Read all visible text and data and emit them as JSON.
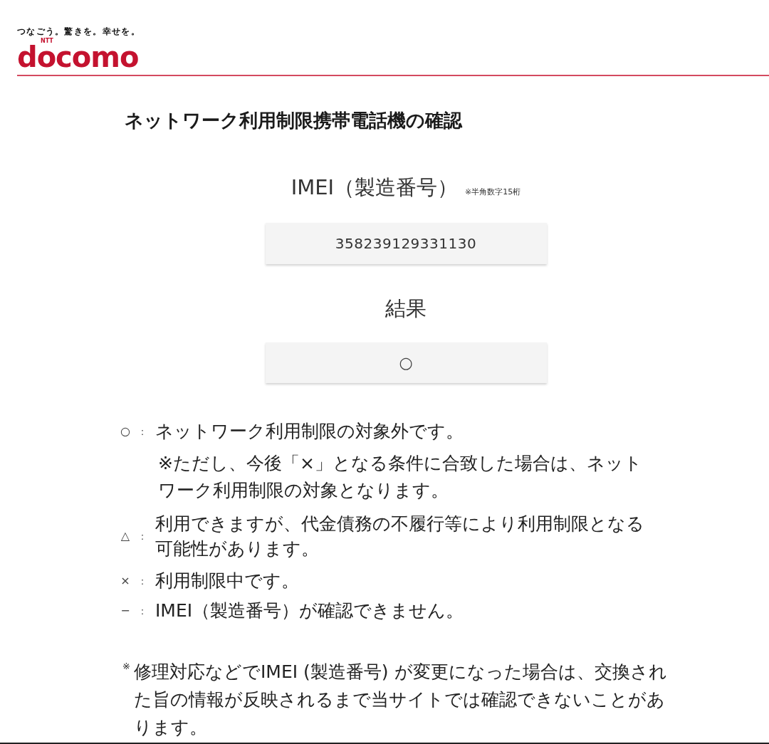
{
  "header": {
    "tagline": "つなごう。驚きを。幸せを。",
    "logo": {
      "brand_mark": "NTT",
      "wordmark": "docomo"
    }
  },
  "page_title": "ネットワーク利用制限携帯電話機の確認",
  "imei_field": {
    "label": "IMEI（製造番号）",
    "note": "※半角数字15桁",
    "value": "358239129331130"
  },
  "result": {
    "label": "結果",
    "value": "○"
  },
  "legend": [
    {
      "symbol": "○",
      "separator": "：",
      "lines": [
        "ネットワーク利用制限の対象外です。"
      ],
      "note_lines": [
        "※ただし、今後「×」となる条件に合致した場合は、ネット",
        "ワーク利用制限の対象となります。"
      ]
    },
    {
      "symbol": "△",
      "separator": "：",
      "lines": [
        "利用できますが、代金債務の不履行等により利用制限となる",
        "可能性があります。"
      ]
    },
    {
      "symbol": "×",
      "separator": "：",
      "lines": [
        "利用制限中です。"
      ]
    },
    {
      "symbol": "−",
      "separator": "：",
      "lines": [
        "IMEI（製造番号）が確認できません。"
      ]
    }
  ],
  "footnote": {
    "mark": "※",
    "lines": [
      "修理対応などでIMEI (製造番号) が変更になった場合は、交換され",
      "た旨の情報が反映されるまで当サイトでは確認できないことがあ",
      "ります。"
    ]
  }
}
